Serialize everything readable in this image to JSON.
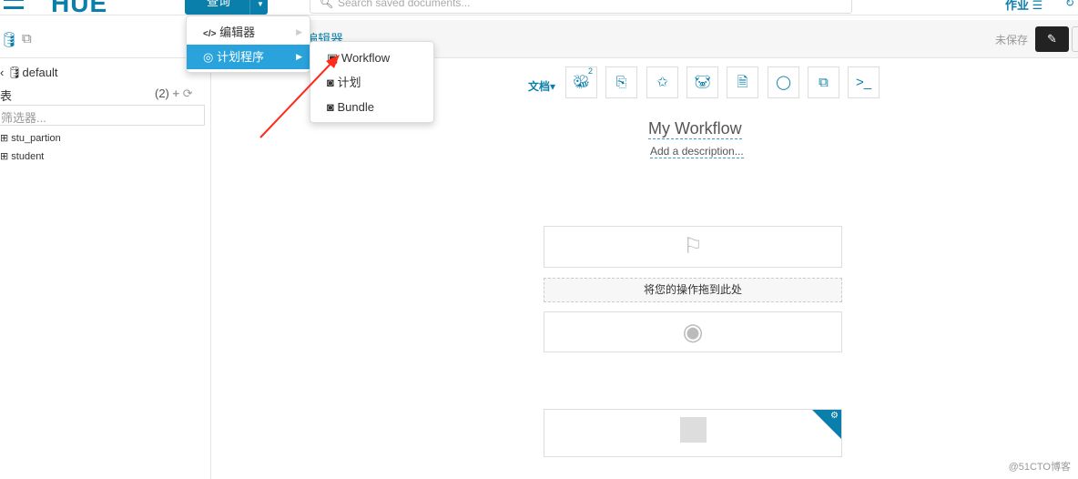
{
  "topbar": {
    "logo": "HUE",
    "query_button": "查询",
    "search_placeholder": "Search saved documents...",
    "jobs_label": "作业"
  },
  "sidebar": {
    "database": "default",
    "tables_label": "表",
    "tables_count": "(2)",
    "filter_placeholder": "筛选器...",
    "tables": [
      "stu_partion",
      "student"
    ]
  },
  "header": {
    "breadcrumb": "编辑器",
    "unsaved": "未保存"
  },
  "dropdown": {
    "items": [
      {
        "label": "编辑器",
        "icon": "code-icon"
      },
      {
        "label": "计划程序",
        "icon": "scheduler-icon",
        "active": true
      }
    ]
  },
  "submenu": {
    "items": [
      "Workflow",
      "计划",
      "Bundle"
    ]
  },
  "toolbar": {
    "docs_label": "文档",
    "hive_badge": "2",
    "tools": [
      "hive",
      "document",
      "spark",
      "pig",
      "file-thermometer",
      "circle",
      "copy",
      "shell"
    ]
  },
  "workflow": {
    "title": "My Workflow",
    "description": "Add a description...",
    "drop_text": "将您的操作拖到此处"
  },
  "watermark": "@51CTO博客",
  "colors": {
    "accent": "#0b7fab",
    "menu_active": "#2aa3dc",
    "arrow": "#ff2a1a"
  }
}
